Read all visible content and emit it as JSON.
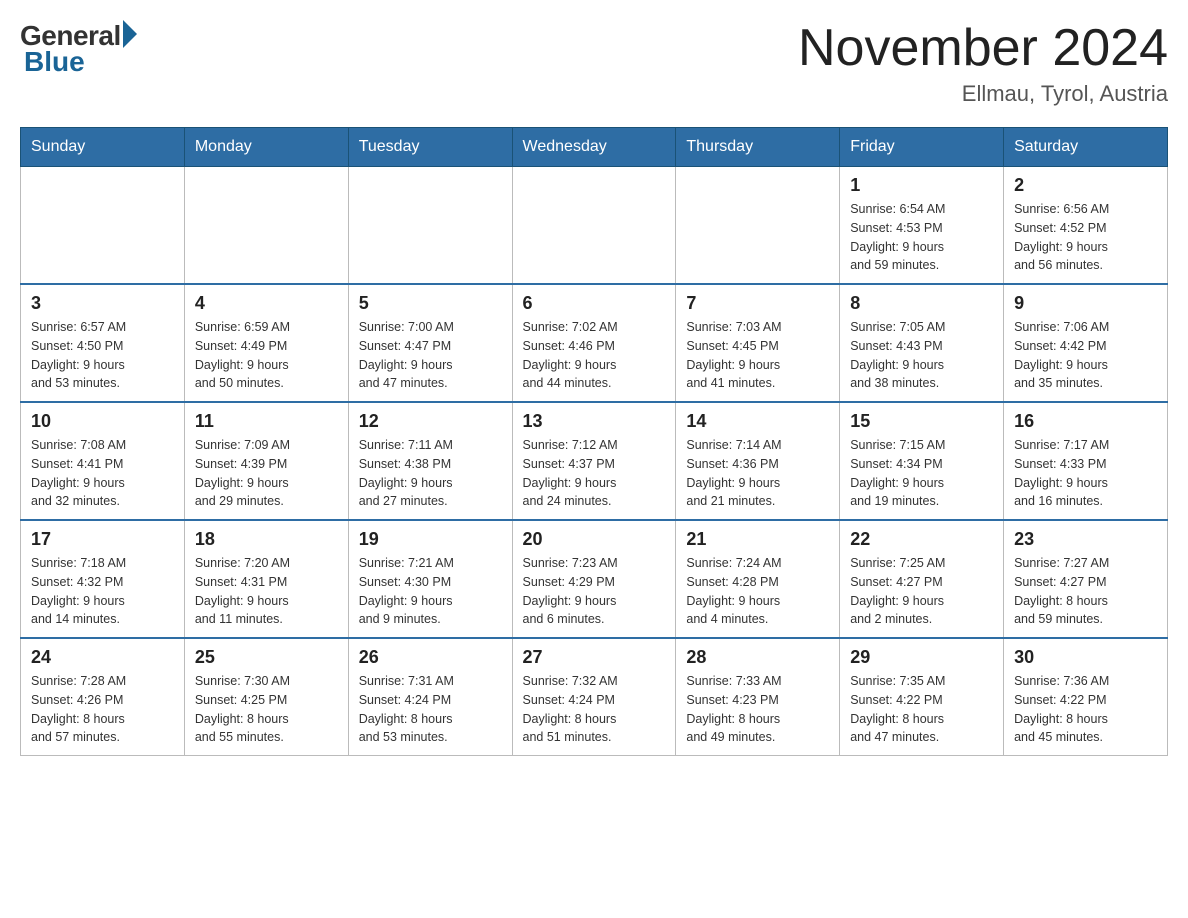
{
  "logo": {
    "general": "General",
    "blue": "Blue",
    "tagline": "Blue"
  },
  "title": "November 2024",
  "subtitle": "Ellmau, Tyrol, Austria",
  "days_of_week": [
    "Sunday",
    "Monday",
    "Tuesday",
    "Wednesday",
    "Thursday",
    "Friday",
    "Saturday"
  ],
  "weeks": [
    [
      {
        "day": "",
        "info": ""
      },
      {
        "day": "",
        "info": ""
      },
      {
        "day": "",
        "info": ""
      },
      {
        "day": "",
        "info": ""
      },
      {
        "day": "",
        "info": ""
      },
      {
        "day": "1",
        "info": "Sunrise: 6:54 AM\nSunset: 4:53 PM\nDaylight: 9 hours\nand 59 minutes."
      },
      {
        "day": "2",
        "info": "Sunrise: 6:56 AM\nSunset: 4:52 PM\nDaylight: 9 hours\nand 56 minutes."
      }
    ],
    [
      {
        "day": "3",
        "info": "Sunrise: 6:57 AM\nSunset: 4:50 PM\nDaylight: 9 hours\nand 53 minutes."
      },
      {
        "day": "4",
        "info": "Sunrise: 6:59 AM\nSunset: 4:49 PM\nDaylight: 9 hours\nand 50 minutes."
      },
      {
        "day": "5",
        "info": "Sunrise: 7:00 AM\nSunset: 4:47 PM\nDaylight: 9 hours\nand 47 minutes."
      },
      {
        "day": "6",
        "info": "Sunrise: 7:02 AM\nSunset: 4:46 PM\nDaylight: 9 hours\nand 44 minutes."
      },
      {
        "day": "7",
        "info": "Sunrise: 7:03 AM\nSunset: 4:45 PM\nDaylight: 9 hours\nand 41 minutes."
      },
      {
        "day": "8",
        "info": "Sunrise: 7:05 AM\nSunset: 4:43 PM\nDaylight: 9 hours\nand 38 minutes."
      },
      {
        "day": "9",
        "info": "Sunrise: 7:06 AM\nSunset: 4:42 PM\nDaylight: 9 hours\nand 35 minutes."
      }
    ],
    [
      {
        "day": "10",
        "info": "Sunrise: 7:08 AM\nSunset: 4:41 PM\nDaylight: 9 hours\nand 32 minutes."
      },
      {
        "day": "11",
        "info": "Sunrise: 7:09 AM\nSunset: 4:39 PM\nDaylight: 9 hours\nand 29 minutes."
      },
      {
        "day": "12",
        "info": "Sunrise: 7:11 AM\nSunset: 4:38 PM\nDaylight: 9 hours\nand 27 minutes."
      },
      {
        "day": "13",
        "info": "Sunrise: 7:12 AM\nSunset: 4:37 PM\nDaylight: 9 hours\nand 24 minutes."
      },
      {
        "day": "14",
        "info": "Sunrise: 7:14 AM\nSunset: 4:36 PM\nDaylight: 9 hours\nand 21 minutes."
      },
      {
        "day": "15",
        "info": "Sunrise: 7:15 AM\nSunset: 4:34 PM\nDaylight: 9 hours\nand 19 minutes."
      },
      {
        "day": "16",
        "info": "Sunrise: 7:17 AM\nSunset: 4:33 PM\nDaylight: 9 hours\nand 16 minutes."
      }
    ],
    [
      {
        "day": "17",
        "info": "Sunrise: 7:18 AM\nSunset: 4:32 PM\nDaylight: 9 hours\nand 14 minutes."
      },
      {
        "day": "18",
        "info": "Sunrise: 7:20 AM\nSunset: 4:31 PM\nDaylight: 9 hours\nand 11 minutes."
      },
      {
        "day": "19",
        "info": "Sunrise: 7:21 AM\nSunset: 4:30 PM\nDaylight: 9 hours\nand 9 minutes."
      },
      {
        "day": "20",
        "info": "Sunrise: 7:23 AM\nSunset: 4:29 PM\nDaylight: 9 hours\nand 6 minutes."
      },
      {
        "day": "21",
        "info": "Sunrise: 7:24 AM\nSunset: 4:28 PM\nDaylight: 9 hours\nand 4 minutes."
      },
      {
        "day": "22",
        "info": "Sunrise: 7:25 AM\nSunset: 4:27 PM\nDaylight: 9 hours\nand 2 minutes."
      },
      {
        "day": "23",
        "info": "Sunrise: 7:27 AM\nSunset: 4:27 PM\nDaylight: 8 hours\nand 59 minutes."
      }
    ],
    [
      {
        "day": "24",
        "info": "Sunrise: 7:28 AM\nSunset: 4:26 PM\nDaylight: 8 hours\nand 57 minutes."
      },
      {
        "day": "25",
        "info": "Sunrise: 7:30 AM\nSunset: 4:25 PM\nDaylight: 8 hours\nand 55 minutes."
      },
      {
        "day": "26",
        "info": "Sunrise: 7:31 AM\nSunset: 4:24 PM\nDaylight: 8 hours\nand 53 minutes."
      },
      {
        "day": "27",
        "info": "Sunrise: 7:32 AM\nSunset: 4:24 PM\nDaylight: 8 hours\nand 51 minutes."
      },
      {
        "day": "28",
        "info": "Sunrise: 7:33 AM\nSunset: 4:23 PM\nDaylight: 8 hours\nand 49 minutes."
      },
      {
        "day": "29",
        "info": "Sunrise: 7:35 AM\nSunset: 4:22 PM\nDaylight: 8 hours\nand 47 minutes."
      },
      {
        "day": "30",
        "info": "Sunrise: 7:36 AM\nSunset: 4:22 PM\nDaylight: 8 hours\nand 45 minutes."
      }
    ]
  ]
}
